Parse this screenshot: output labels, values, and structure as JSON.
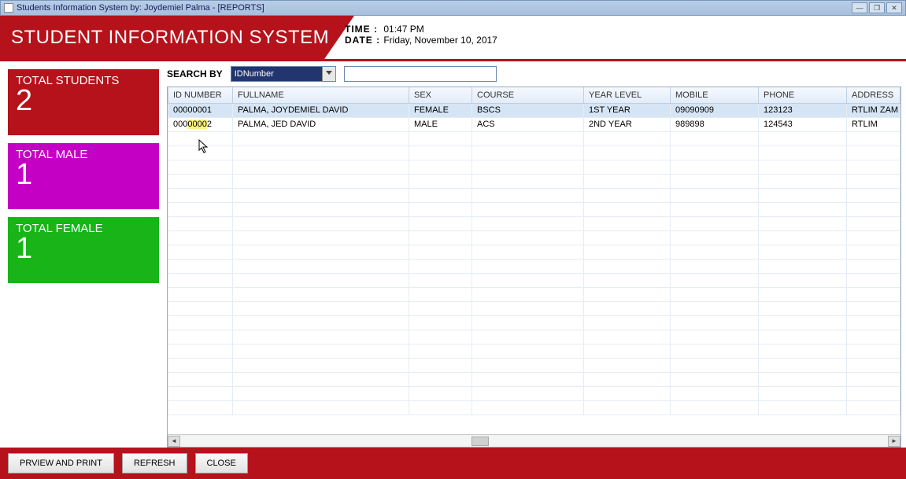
{
  "window": {
    "title": "Students Information System by: Joydemiel Palma - [REPORTS]"
  },
  "header": {
    "system_title": "STUDENT INFORMATION SYSTEM",
    "time_label": "TIME :",
    "time_value": "01:47 PM",
    "date_label": "DATE :",
    "date_value": "Friday, November 10, 2017"
  },
  "stats": {
    "total_students": {
      "title": "TOTAL STUDENTS",
      "value": "2"
    },
    "total_male": {
      "title": "TOTAL MALE",
      "value": "1"
    },
    "total_female": {
      "title": "TOTAL FEMALE",
      "value": "1"
    }
  },
  "search": {
    "label": "SEARCH BY",
    "field_selected": "IDNumber",
    "query": ""
  },
  "grid": {
    "columns": [
      "ID NUMBER",
      "FULLNAME",
      "SEX",
      "COURSE",
      "YEAR LEVEL",
      "MOBILE",
      "PHONE",
      "ADDRESS"
    ],
    "rows": [
      {
        "id": "00000001",
        "fullname": "PALMA, JOYDEMIEL DAVID",
        "sex": "FEMALE",
        "course": "BSCS",
        "year": "1ST YEAR",
        "mobile": "09090909",
        "phone": "123123",
        "address": "RTLIM ZAM"
      },
      {
        "id": "00000002",
        "fullname": "PALMA, JED DAVID",
        "sex": "MALE",
        "course": "ACS",
        "year": "2ND YEAR",
        "mobile": "989898",
        "phone": "124543",
        "address": "RTLIM"
      }
    ]
  },
  "footer": {
    "preview": "PRVIEW AND PRINT",
    "refresh": "REFRESH",
    "close": "CLOSE"
  }
}
